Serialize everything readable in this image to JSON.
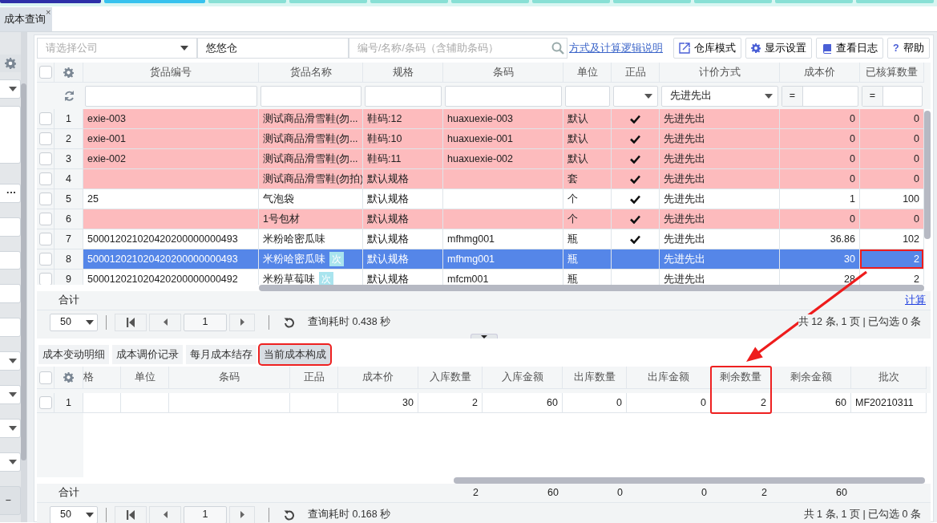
{
  "module_tabs": [
    {
      "color": "#2c30a8"
    },
    {
      "color": "#36c2ee"
    },
    {
      "color": "#88e0d5"
    },
    {
      "color": "#88e0d5"
    },
    {
      "color": "#88e0d5"
    },
    {
      "color": "#88e0d5"
    },
    {
      "color": "#88e0d5"
    },
    {
      "color": "#88e0d5"
    },
    {
      "color": "#88e0d5"
    },
    {
      "color": "#88e0d5"
    },
    {
      "color": "#88e0d5"
    }
  ],
  "page_tab": {
    "label": "成本查询",
    "close": "×"
  },
  "sidebar": [
    {
      "kind": "gear"
    },
    {
      "kind": "select"
    },
    {
      "kind": "panel"
    },
    {
      "kind": "more",
      "label": "···"
    },
    {
      "kind": "input"
    },
    {
      "kind": "input"
    },
    {
      "kind": "input"
    },
    {
      "kind": "input"
    },
    {
      "kind": "select"
    },
    {
      "kind": "select"
    },
    {
      "kind": "select"
    },
    {
      "kind": "select"
    },
    {
      "kind": "dash",
      "label": "−"
    }
  ],
  "filters": {
    "company": {
      "placeholder": "请选择公司"
    },
    "warehouse": {
      "value": "悠悠仓"
    },
    "search": {
      "placeholder": "编号/名称/条码（含辅助条码）"
    }
  },
  "help_link": "方式及计算逻辑说明",
  "toolbar_buttons": [
    {
      "label": "仓库模式",
      "kind": "export"
    },
    {
      "label": "显示设置",
      "kind": "gear"
    },
    {
      "label": "查看日志",
      "kind": "book"
    },
    {
      "label": "帮助",
      "kind": "question",
      "glyph": "?"
    }
  ],
  "main_grid": {
    "all_checked": false,
    "columns": [
      {
        "label": "货品编号",
        "kind": "text",
        "filter": {
          "kind": "text"
        }
      },
      {
        "label": "货品名称",
        "kind": "text",
        "filter": {
          "kind": "text"
        }
      },
      {
        "label": "规格",
        "kind": "text",
        "filter": {
          "kind": "text"
        }
      },
      {
        "label": "条码",
        "kind": "text",
        "filter": {
          "kind": "text"
        }
      },
      {
        "label": "单位",
        "kind": "text",
        "filter": {
          "kind": "text"
        }
      },
      {
        "label": "正品",
        "kind": "check",
        "filter": {
          "kind": "select"
        }
      },
      {
        "label": "计价方式",
        "kind": "text",
        "filter": {
          "kind": "select",
          "value": "先进先出"
        }
      },
      {
        "label": "成本价",
        "kind": "number",
        "filter": {
          "kind": "compare",
          "operator": "="
        }
      },
      {
        "label": "已核算数量",
        "kind": "number",
        "filter": {
          "kind": "compare",
          "operator": "="
        }
      }
    ],
    "rows": [
      {
        "no": "1",
        "checked": false,
        "flagged": true,
        "selected": false,
        "code": "exie-003",
        "name": "测试商品滑雪鞋(勿...",
        "spec": "鞋码:12",
        "barcode": "huaxuexie-003",
        "unit": "默认",
        "genuine": true,
        "pricing": "先进先出",
        "cost": "0",
        "qty": "0"
      },
      {
        "no": "2",
        "checked": false,
        "flagged": true,
        "selected": false,
        "code": "exie-001",
        "name": "测试商品滑雪鞋(勿...",
        "spec": "鞋码:10",
        "barcode": "huaxuexie-001",
        "unit": "默认",
        "genuine": true,
        "pricing": "先进先出",
        "cost": "0",
        "qty": "0"
      },
      {
        "no": "3",
        "checked": false,
        "flagged": true,
        "selected": false,
        "code": "exie-002",
        "name": "测试商品滑雪鞋(勿...",
        "spec": "鞋码:11",
        "barcode": "huaxuexie-002",
        "unit": "默认",
        "genuine": true,
        "pricing": "先进先出",
        "cost": "0",
        "qty": "0"
      },
      {
        "no": "4",
        "checked": false,
        "flagged": true,
        "selected": false,
        "name": "测试商品滑雪鞋(勿拍)",
        "spec": "默认规格",
        "unit": "套",
        "genuine": true,
        "pricing": "先进先出",
        "cost": "0",
        "qty": "0"
      },
      {
        "no": "5",
        "checked": false,
        "flagged": false,
        "selected": false,
        "code": "25",
        "name": "气泡袋",
        "spec": "默认规格",
        "unit": "个",
        "genuine": true,
        "pricing": "先进先出",
        "cost": "1",
        "qty": "100"
      },
      {
        "no": "6",
        "checked": false,
        "flagged": true,
        "selected": false,
        "name": "1号包材",
        "spec": "默认规格",
        "unit": "个",
        "genuine": true,
        "pricing": "先进先出",
        "cost": "0",
        "qty": "0"
      },
      {
        "no": "7",
        "checked": false,
        "flagged": false,
        "selected": false,
        "code": "500012021020420200000000493",
        "name": "米粉哈密瓜味",
        "spec": "默认规格",
        "barcode": "mfhmg001",
        "unit": "瓶",
        "genuine": true,
        "pricing": "先进先出",
        "cost": "36.86",
        "qty": "102"
      },
      {
        "no": "8",
        "checked": false,
        "flagged": false,
        "selected": true,
        "annotated": true,
        "code": "500012021020420200000000493",
        "name": "米粉哈密瓜味",
        "badge": "次",
        "spec": "默认规格",
        "barcode": "mfhmg001",
        "unit": "瓶",
        "genuine": false,
        "pricing": "先进先出",
        "cost": "30",
        "qty": "2"
      },
      {
        "no": "9",
        "checked": false,
        "flagged": false,
        "selected": false,
        "code": "500012021020420200000000492",
        "name": "米粉草莓味",
        "badge": "次",
        "spec": "默认规格",
        "barcode": "mfcm001",
        "unit": "瓶",
        "genuine": false,
        "pricing": "先进先出",
        "cost": "28",
        "qty": "2"
      }
    ],
    "total_label": "合计",
    "calc_link": "计算",
    "pager": {
      "page_size": "50",
      "page": "1",
      "timing": "查询耗时 0.438 秒",
      "summary": "共 12 条, 1 页 | 已勾选 0 条"
    }
  },
  "bottom_tabs": [
    {
      "label": "成本变动明细",
      "selected": false
    },
    {
      "label": "成本调价记录",
      "selected": false
    },
    {
      "label": "每月成本结存",
      "selected": false
    },
    {
      "label": "当前成本构成",
      "selected": true,
      "annotated": true
    }
  ],
  "bottom_grid": {
    "all_checked": false,
    "columns": [
      {
        "label": "格"
      },
      {
        "label": "单位"
      },
      {
        "label": "条码"
      },
      {
        "label": "正品"
      },
      {
        "label": "成本价",
        "kind": "number"
      },
      {
        "label": "入库数量",
        "kind": "number"
      },
      {
        "label": "入库金额",
        "kind": "number"
      },
      {
        "label": "出库数量",
        "kind": "number"
      },
      {
        "label": "出库金额",
        "kind": "number"
      },
      {
        "label": "剩余数量",
        "kind": "number",
        "annotated": true
      },
      {
        "label": "剩余金额",
        "kind": "number"
      },
      {
        "label": "批次",
        "kind": "text"
      }
    ],
    "rows": [
      {
        "no": "1",
        "checked": false,
        "cost": "30",
        "in_qty": "2",
        "in_amount": "60",
        "out_qty": "0",
        "out_amount": "0",
        "remain_qty": "2",
        "remain_amount": "60",
        "batch": "MF20210311"
      }
    ],
    "total_label": "合计",
    "totals": {
      "in_qty": "2",
      "in_amount": "60",
      "out_qty": "0",
      "out_amount": "0",
      "remain_qty": "2",
      "remain_amount": "60"
    },
    "pager": {
      "page_size": "50",
      "page": "1",
      "timing": "查询耗时 0.168 秒",
      "summary": "共 1 条, 1 页 | 已勾选 0 条"
    }
  }
}
